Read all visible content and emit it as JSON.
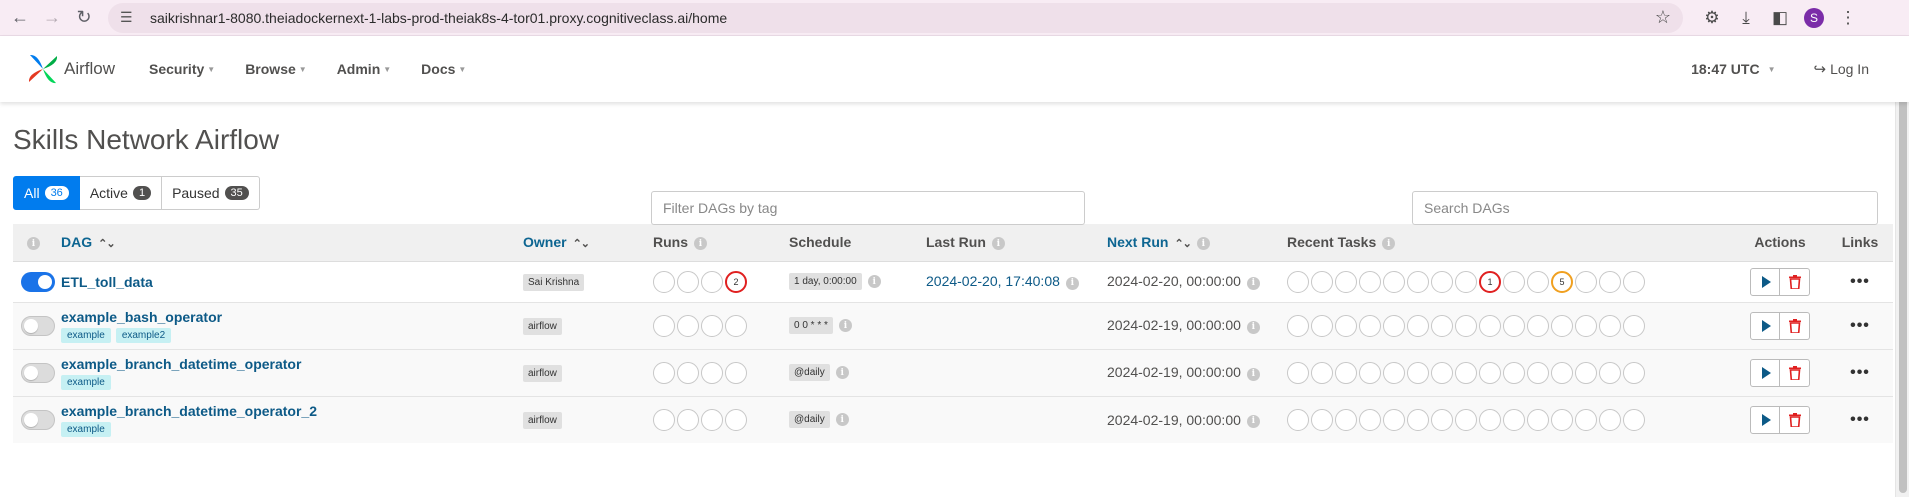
{
  "browser": {
    "url": "saikrishnar1-8080.theiadockernext-1-labs-prod-theiak8s-4-tor01.proxy.cognitiveclass.ai/home",
    "profile_initial": "S",
    "profile_color": "#7b2ca8"
  },
  "nav": {
    "brand": "Airflow",
    "menu": [
      {
        "label": "Security"
      },
      {
        "label": "Browse"
      },
      {
        "label": "Admin"
      },
      {
        "label": "Docs"
      }
    ],
    "time": "18:47 UTC",
    "login": "Log In"
  },
  "page": {
    "title": "Skills Network Airflow"
  },
  "filters": {
    "all_label": "All",
    "all_count": "36",
    "active_label": "Active",
    "active_count": "1",
    "paused_label": "Paused",
    "paused_count": "35",
    "tag_placeholder": "Filter DAGs by tag",
    "search_placeholder": "Search DAGs"
  },
  "table": {
    "headers": {
      "dag": "DAG",
      "owner": "Owner",
      "runs": "Runs",
      "schedule": "Schedule",
      "last_run": "Last Run",
      "next_run": "Next Run",
      "recent_tasks": "Recent Tasks",
      "actions": "Actions",
      "links": "Links"
    },
    "rows": [
      {
        "name": "ETL_toll_data",
        "toggle": "on",
        "tags": [],
        "owner": "Sai Krishna",
        "runs": [
          "",
          "",
          "",
          "2"
        ],
        "runs_states": [
          "none",
          "none",
          "none",
          "failed"
        ],
        "schedule": "1 day, 0:00:00",
        "last_run": "2024-02-20, 17:40:08",
        "next_run": "2024-02-20, 00:00:00",
        "tasks": [
          "",
          "",
          "",
          "",
          "",
          "",
          "",
          "",
          "1",
          "",
          "",
          "5",
          "",
          "",
          ""
        ],
        "task_states": [
          "none",
          "none",
          "none",
          "none",
          "none",
          "none",
          "none",
          "none",
          "failed",
          "none",
          "none",
          "retry",
          "none",
          "none",
          "none"
        ]
      },
      {
        "name": "example_bash_operator",
        "toggle": "off",
        "tags": [
          "example",
          "example2"
        ],
        "owner": "airflow",
        "runs": [
          "",
          "",
          "",
          ""
        ],
        "runs_states": [
          "none",
          "none",
          "none",
          "none"
        ],
        "schedule": "0 0 * * *",
        "last_run": "",
        "next_run": "2024-02-19, 00:00:00",
        "tasks": [
          "",
          "",
          "",
          "",
          "",
          "",
          "",
          "",
          "",
          "",
          "",
          "",
          "",
          "",
          ""
        ],
        "task_states": [
          "none",
          "none",
          "none",
          "none",
          "none",
          "none",
          "none",
          "none",
          "none",
          "none",
          "none",
          "none",
          "none",
          "none",
          "none"
        ]
      },
      {
        "name": "example_branch_datetime_operator",
        "toggle": "off",
        "tags": [
          "example"
        ],
        "owner": "airflow",
        "runs": [
          "",
          "",
          "",
          ""
        ],
        "runs_states": [
          "none",
          "none",
          "none",
          "none"
        ],
        "schedule": "@daily",
        "last_run": "",
        "next_run": "2024-02-19, 00:00:00",
        "tasks": [
          "",
          "",
          "",
          "",
          "",
          "",
          "",
          "",
          "",
          "",
          "",
          "",
          "",
          "",
          ""
        ],
        "task_states": [
          "none",
          "none",
          "none",
          "none",
          "none",
          "none",
          "none",
          "none",
          "none",
          "none",
          "none",
          "none",
          "none",
          "none",
          "none"
        ]
      },
      {
        "name": "example_branch_datetime_operator_2",
        "toggle": "off",
        "tags": [
          "example"
        ],
        "owner": "airflow",
        "runs": [
          "",
          "",
          "",
          ""
        ],
        "runs_states": [
          "none",
          "none",
          "none",
          "none"
        ],
        "schedule": "@daily",
        "last_run": "",
        "next_run": "2024-02-19, 00:00:00",
        "tasks": [
          "",
          "",
          "",
          "",
          "",
          "",
          "",
          "",
          "",
          "",
          "",
          "",
          "",
          "",
          ""
        ],
        "task_states": [
          "none",
          "none",
          "none",
          "none",
          "none",
          "none",
          "none",
          "none",
          "none",
          "none",
          "none",
          "none",
          "none",
          "none",
          "none"
        ]
      }
    ]
  },
  "colors": {
    "primary": "#017cee",
    "link": "#0d5a87",
    "failed": "#e02020",
    "retry": "#f0a020",
    "tag_bg": "#c6f0f3"
  }
}
